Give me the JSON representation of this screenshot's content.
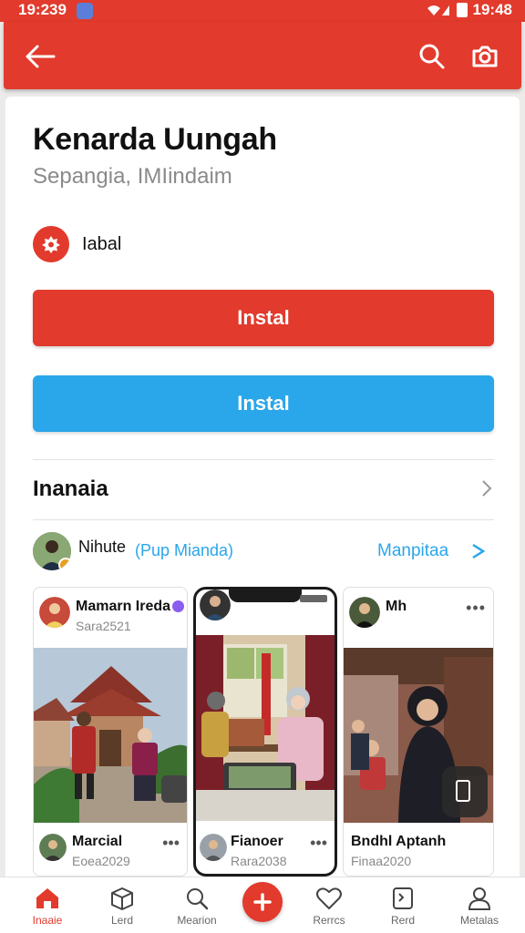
{
  "status_bar": {
    "time_left": "19:239",
    "time_right": "19:48"
  },
  "header": {
    "title": "Kenarda Uungah",
    "subtitle": "Sepangia, IMIindaim"
  },
  "tag": {
    "label": "Iabal"
  },
  "buttons": {
    "primary_label": "Instal",
    "secondary_label": "Instal"
  },
  "section": {
    "title": "Inanaia"
  },
  "feed": {
    "name": "Nihute",
    "sub": "(Pup Mianda)",
    "link": "Manpitaa"
  },
  "posts": [
    {
      "name": "Mamarn Ireda",
      "date": "Sara2521",
      "foot_name": "Marcial",
      "foot_date": "Eoea2029"
    },
    {
      "foot_name": "Fianoer",
      "foot_date": "Rara2038"
    },
    {
      "name": "Mh",
      "foot_name": "Bndhl Aptanh",
      "foot_date": "Finaa2020"
    }
  ],
  "nav": [
    {
      "label": "Inaaie",
      "icon": "home-icon"
    },
    {
      "label": "Lerd",
      "icon": "box-icon"
    },
    {
      "label": "Mearion",
      "icon": "search-icon"
    },
    {
      "label": "",
      "icon": "plus-icon"
    },
    {
      "label": "Rerrcs",
      "icon": "heart-icon"
    },
    {
      "label": "Rerd",
      "icon": "card-icon"
    },
    {
      "label": "Metalas",
      "icon": "person-icon"
    }
  ],
  "colors": {
    "brand_red": "#e23a2c",
    "accent_blue": "#2aa6ea"
  }
}
